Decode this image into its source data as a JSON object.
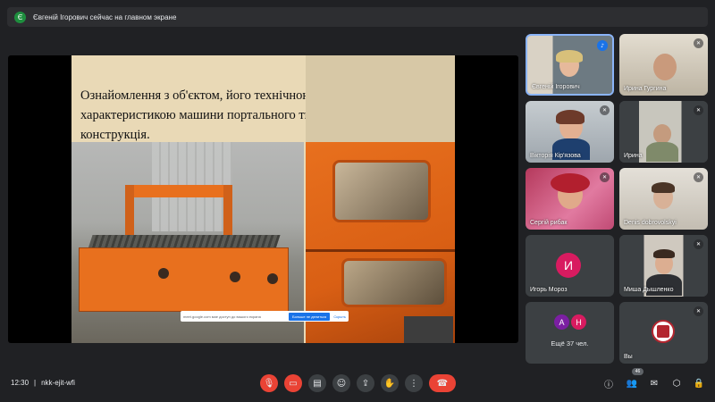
{
  "banner": {
    "initial": "Є",
    "text": "Євгеній Ігорович сейчас на главном экране"
  },
  "slide": {
    "title": "Ознайомлення з об'єктом, його технічною оснасткою і характеристикою машини портального типу. загальна конструкція."
  },
  "share_bar": {
    "info": "meet.google.com мае доступ до вашого екрана",
    "stop_label": "Больше не делиться",
    "hide_label": "Скрыть"
  },
  "participants": [
    {
      "name": "Євгеній Ігорович",
      "speaking": true
    },
    {
      "name": "Ирина Гургина"
    },
    {
      "name": "Вікторія Кір'язова"
    },
    {
      "name": "Ирина"
    },
    {
      "name": "Сергій рибак"
    },
    {
      "name": "Denis dobrovolskyi"
    },
    {
      "name": "Игорь Мороз",
      "initial": "И",
      "color": "#d81b60"
    },
    {
      "name": "Миша Дышленко"
    },
    {
      "name": "Ещё 37 чел.",
      "initials": [
        "А",
        "Н"
      ],
      "colors": [
        "#7b1fa2",
        "#d81b60"
      ]
    },
    {
      "name": "Вы"
    }
  ],
  "bottom": {
    "time": "12:30",
    "separator": "|",
    "meeting_code": "nkk-ejit-wfi",
    "participant_count": "46"
  },
  "colors": {
    "background": "#202124",
    "tile": "#3c4043",
    "danger": "#ea4335",
    "accent": "#1a73e8"
  }
}
